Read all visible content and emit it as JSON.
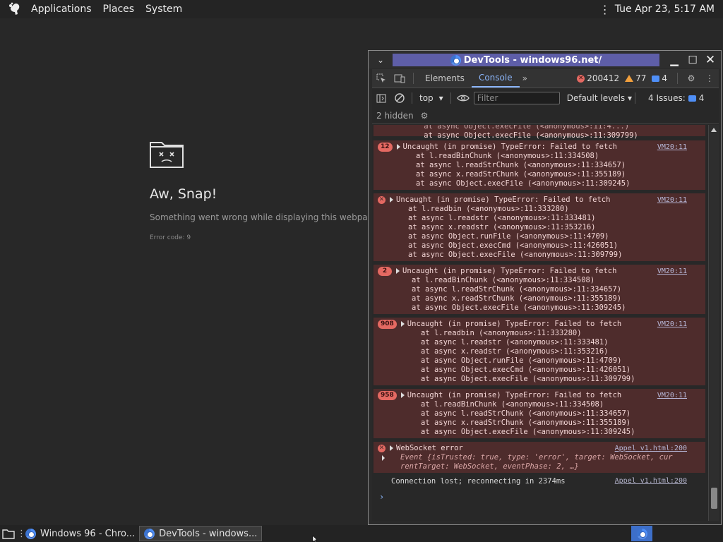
{
  "top_panel": {
    "menus": [
      "Applications",
      "Places",
      "System"
    ],
    "clock": "Tue Apr 23,  5:17 AM"
  },
  "crash_page": {
    "title": "Aw, Snap!",
    "message": "Something went wrong while displaying this webpage.",
    "error_code": "Error code: 9"
  },
  "devtools": {
    "window_title": "DevTools - windows96.net/",
    "tabs": [
      "Elements",
      "Console"
    ],
    "active_tab": "Console",
    "error_count": "200412",
    "warning_count": "77",
    "message_count": "4",
    "context": "top",
    "filter_placeholder": "Filter",
    "levels": "Default levels",
    "issues_label": "4 Issues:",
    "issues_count": "4",
    "hidden": "2 hidden"
  },
  "console": {
    "partial_lines": [
      "    at async Object.execFile (<anonymous>:11:309799)"
    ],
    "entries": [
      {
        "badge": "12",
        "message": "Uncaught (in promise) TypeError: Failed to fetch",
        "source": "VM20:11",
        "stack": [
          "at l.readBinChunk (<anonymous>:11:334508)",
          "at async l.readStrChunk (<anonymous>:11:334657)",
          "at async x.readStrChunk (<anonymous>:11:355189)",
          "at async Object.execFile (<anonymous>:11:309245)"
        ]
      },
      {
        "badge": "",
        "message": "Uncaught (in promise) TypeError: Failed to fetch",
        "source": "VM20:11",
        "stack": [
          "at l.readbin (<anonymous>:11:333280)",
          "at async l.readstr (<anonymous>:11:333481)",
          "at async x.readstr (<anonymous>:11:353216)",
          "at async Object.runFile (<anonymous>:11:4709)",
          "at async Object.execCmd (<anonymous>:11:426051)",
          "at async Object.execFile (<anonymous>:11:309799)"
        ]
      },
      {
        "badge": "2",
        "message": "Uncaught (in promise) TypeError: Failed to fetch",
        "source": "VM20:11",
        "stack": [
          "at l.readBinChunk (<anonymous>:11:334508)",
          "at async l.readStrChunk (<anonymous>:11:334657)",
          "at async x.readStrChunk (<anonymous>:11:355189)",
          "at async Object.execFile (<anonymous>:11:309245)"
        ]
      },
      {
        "badge": "908",
        "message": "Uncaught (in promise) TypeError: Failed to fetch",
        "source": "VM20:11",
        "stack": [
          "at l.readbin (<anonymous>:11:333280)",
          "at async l.readstr (<anonymous>:11:333481)",
          "at async x.readstr (<anonymous>:11:353216)",
          "at async Object.runFile (<anonymous>:11:4709)",
          "at async Object.execCmd (<anonymous>:11:426051)",
          "at async Object.execFile (<anonymous>:11:309799)"
        ]
      },
      {
        "badge": "958",
        "message": "Uncaught (in promise) TypeError: Failed to fetch",
        "source": "VM20:11",
        "stack": [
          "at l.readBinChunk (<anonymous>:11:334508)",
          "at async l.readStrChunk (<anonymous>:11:334657)",
          "at async x.readStrChunk (<anonymous>:11:355189)",
          "at async Object.execFile (<anonymous>:11:309245)"
        ]
      }
    ],
    "websocket": {
      "message": "WebSocket error",
      "source": "Appel v1.html:200",
      "event_line_1": "Event {isTrusted: true, type: 'error', target: WebSocket, cur",
      "event_line_2": "rentTarget: WebSocket, eventPhase: 2, …}"
    },
    "info": {
      "message": "Connection lost; reconnecting in 2374ms",
      "source": "Appel v1.html:200"
    }
  },
  "taskbar": {
    "tasks": [
      "Windows 96 - Chro...",
      "DevTools - windows..."
    ]
  },
  "colors": {
    "error_bg": "#4e2c2c",
    "error_badge": "#e46962",
    "accent": "#8ab4f8",
    "title_highlight": "#5e5ea8"
  }
}
